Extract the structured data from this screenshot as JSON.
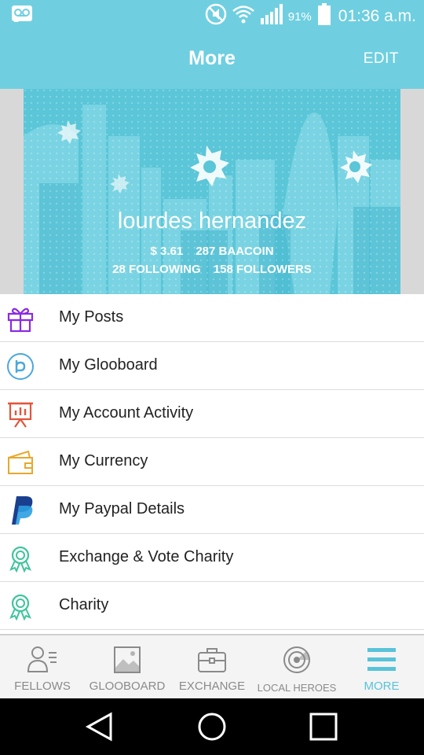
{
  "status_bar": {
    "battery_percent": "91%",
    "time": "01:36 a.m.",
    "icons": [
      "voicemail-icon",
      "mute-icon",
      "wifi-icon",
      "signal-icon",
      "battery-icon"
    ]
  },
  "header": {
    "title": "More",
    "edit_label": "EDIT"
  },
  "profile": {
    "name": "lourdes hernandez",
    "balance": "$ 3.61",
    "baacoin": "287 BAACOIN",
    "following": "28 FOLLOWING",
    "followers": "158 FOLLOWERS"
  },
  "menu": {
    "items": [
      {
        "label": "My Posts",
        "icon": "gift-icon",
        "color": "#8a2be2"
      },
      {
        "label": "My Glooboard",
        "icon": "thumb-coin-icon",
        "color": "#4aa8dc"
      },
      {
        "label": "My Account Activity",
        "icon": "presentation-chart-icon",
        "color": "#e2553b"
      },
      {
        "label": "My Currency",
        "icon": "wallet-icon",
        "color": "#e6a92c"
      },
      {
        "label": "My Paypal Details",
        "icon": "paypal-icon",
        "color": "#1b3f8f"
      },
      {
        "label": "Exchange & Vote Charity",
        "icon": "ribbon-award-icon",
        "color": "#3ec49c"
      },
      {
        "label": "Charity",
        "icon": "ribbon-award-icon",
        "color": "#3ec49c"
      }
    ]
  },
  "bottom_nav": {
    "tabs": [
      {
        "label": "FELLOWS",
        "icon": "fellows-icon"
      },
      {
        "label": "GLOOBOARD",
        "icon": "image-icon"
      },
      {
        "label": "EXCHANGE",
        "icon": "briefcase-icon"
      },
      {
        "label": "LOCAL HEROES",
        "icon": "radar-icon"
      },
      {
        "label": "MORE",
        "icon": "menu-icon",
        "active": true
      }
    ],
    "active_color": "#59c3d9"
  },
  "colors": {
    "accent": "#6fcfe0",
    "banner": "#5ac6d8"
  }
}
